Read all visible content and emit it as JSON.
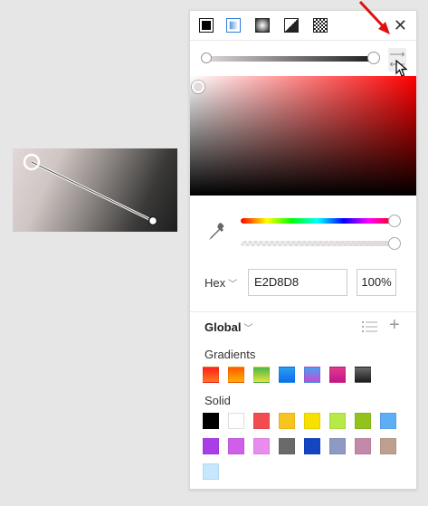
{
  "panel": {
    "fill_types": [
      "solid",
      "linear-gradient",
      "radial-gradient",
      "angular-gradient",
      "image-fill"
    ],
    "selected_fill_type": "linear-gradient",
    "close_icon": "close-icon",
    "swap_icon": "swap-arrows-icon"
  },
  "color": {
    "format": "Hex",
    "hex_value": "E2D8D8",
    "alpha_value": "100%"
  },
  "library": {
    "title": "Global",
    "gradients_label": "Gradients",
    "solid_label": "Solid",
    "gradients": [
      [
        "#ff1f1f",
        "#ff7b1a"
      ],
      [
        "#ff5a00",
        "#ffb100"
      ],
      [
        "#4cb848",
        "#e8e23a"
      ],
      [
        "#2d9cf0",
        "#0a6ff0"
      ],
      [
        "#4aa0ee",
        "#c64bd8"
      ],
      [
        "#e03a8a",
        "#c4158f"
      ],
      [
        "#6a6a6a",
        "#1c1c1c"
      ]
    ],
    "solids": [
      "#000000",
      "#ffffff",
      "#f34c50",
      "#f8c41f",
      "#f8e100",
      "#b5ea47",
      "#92c21c",
      "#5eaef5",
      "#aa3de8",
      "#cf5ee8",
      "#e98cf0",
      "#6a6a6a",
      "#1446c4",
      "#8c9ac4",
      "#c489a8",
      "#bfa08e",
      "#c6e8ff"
    ]
  }
}
